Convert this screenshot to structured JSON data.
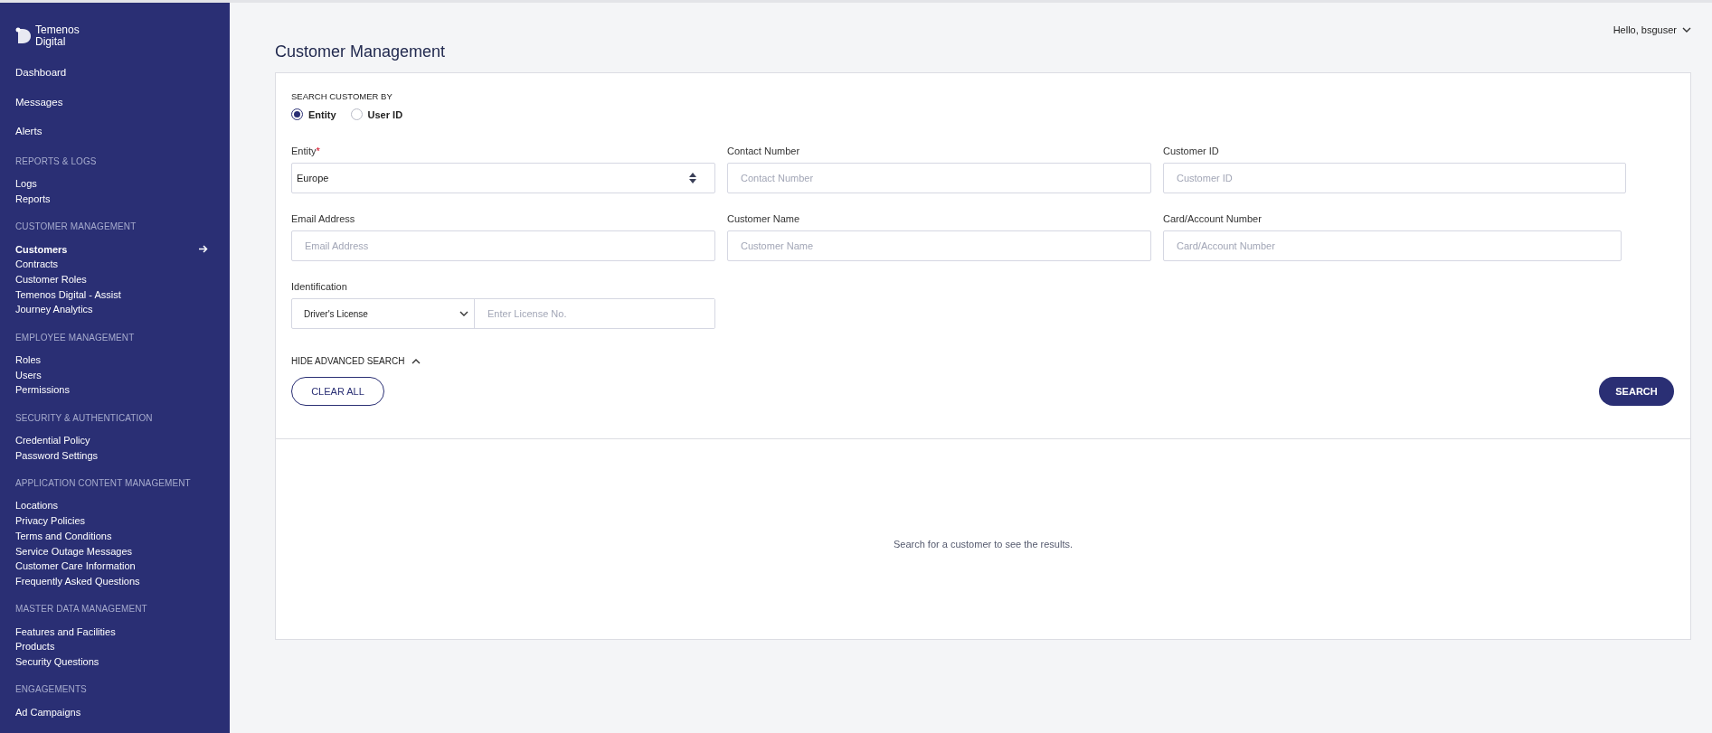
{
  "sidebar": {
    "logo": {
      "line1": "Temenos",
      "line2": "Digital"
    },
    "top_items": [
      {
        "label": "Dashboard",
        "selected": false
      },
      {
        "label": "Messages",
        "selected": false
      },
      {
        "label": "Alerts",
        "selected": false
      }
    ],
    "sections": [
      {
        "header": "REPORTS & LOGS",
        "items": [
          {
            "label": "Logs",
            "selected": false
          },
          {
            "label": "Reports",
            "selected": false
          }
        ]
      },
      {
        "header": "CUSTOMER MANAGEMENT",
        "items": [
          {
            "label": "Customers",
            "selected": true
          },
          {
            "label": "Contracts",
            "selected": false
          },
          {
            "label": "Customer Roles",
            "selected": false
          },
          {
            "label": "Temenos Digital - Assist",
            "selected": false
          },
          {
            "label": "Journey Analytics",
            "selected": false
          }
        ]
      },
      {
        "header": "EMPLOYEE MANAGEMENT",
        "items": [
          {
            "label": "Roles",
            "selected": false
          },
          {
            "label": "Users",
            "selected": false
          },
          {
            "label": "Permissions",
            "selected": false
          }
        ]
      },
      {
        "header": "SECURITY & AUTHENTICATION",
        "items": [
          {
            "label": "Credential Policy",
            "selected": false
          },
          {
            "label": "Password Settings",
            "selected": false
          }
        ]
      },
      {
        "header": "APPLICATION CONTENT MANAGEMENT",
        "items": [
          {
            "label": "Locations",
            "selected": false
          },
          {
            "label": "Privacy Policies",
            "selected": false
          },
          {
            "label": "Terms and Conditions",
            "selected": false
          },
          {
            "label": "Service Outage Messages",
            "selected": false
          },
          {
            "label": "Customer Care Information",
            "selected": false
          },
          {
            "label": "Frequently Asked Questions",
            "selected": false
          }
        ]
      },
      {
        "header": "MASTER DATA MANAGEMENT",
        "items": [
          {
            "label": "Features and Facilities",
            "selected": false
          },
          {
            "label": "Products",
            "selected": false
          },
          {
            "label": "Security Questions",
            "selected": false
          }
        ]
      },
      {
        "header": "ENGAGEMENTS",
        "items": [
          {
            "label": "Ad Campaigns",
            "selected": false
          }
        ]
      }
    ]
  },
  "user_menu": {
    "greeting": "Hello, bsguser"
  },
  "page_title": "Customer Management",
  "search": {
    "search_by_label": "SEARCH CUSTOMER BY",
    "search_by_options": [
      {
        "label": "Entity",
        "selected": true
      },
      {
        "label": "User ID",
        "selected": false
      }
    ],
    "fields": [
      {
        "kind": "select",
        "label": "Entity",
        "required": true,
        "value": "Europe"
      },
      {
        "kind": "text",
        "label": "Contact Number",
        "required": false,
        "placeholder": "Contact Number"
      },
      {
        "kind": "text",
        "label": "Customer ID",
        "required": false,
        "placeholder": "Customer ID"
      },
      {
        "kind": "text",
        "label": "Email Address",
        "required": false,
        "placeholder": "Email Address"
      },
      {
        "kind": "text",
        "label": "Customer Name",
        "required": false,
        "placeholder": "Customer Name"
      },
      {
        "kind": "text",
        "label": "Card/Account Number",
        "required": false,
        "placeholder": "Card/Account Number"
      },
      {
        "kind": "identification",
        "label": "Identification",
        "required": false,
        "type_value": "Driver's License",
        "placeholder": "Enter License No."
      }
    ],
    "required_mark": "*",
    "advanced_toggle": "HIDE ADVANCED SEARCH",
    "clear_button": "CLEAR ALL",
    "search_button": "SEARCH"
  },
  "results": {
    "empty_message": "Search for a customer to see the results."
  }
}
